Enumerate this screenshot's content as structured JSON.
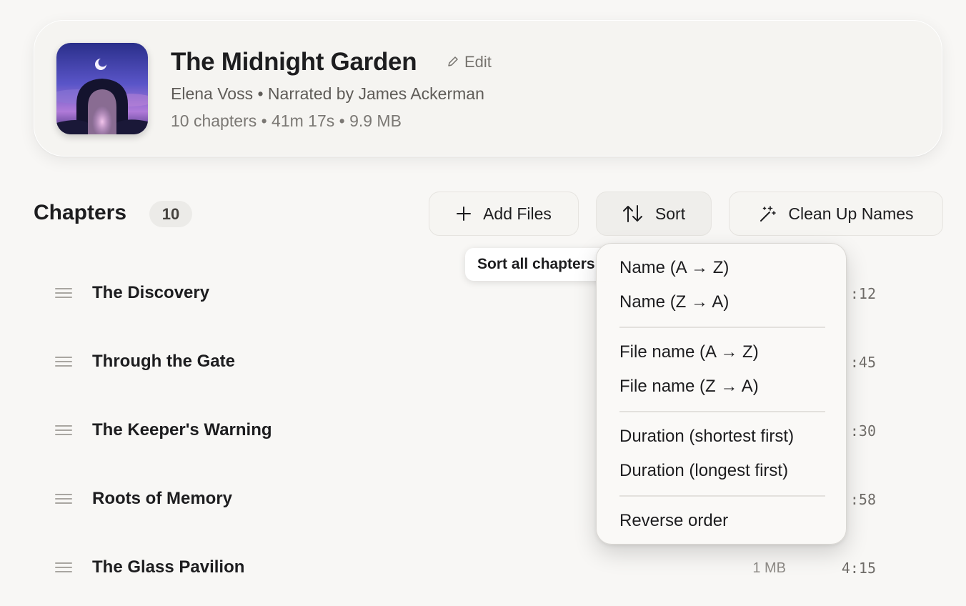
{
  "book": {
    "title": "The Midnight Garden",
    "edit_label": "Edit",
    "author_line": "Elena Voss • Narrated by James Ackerman",
    "meta_line": "10 chapters • 41m 17s • 9.9 MB",
    "cover_icon": "garden-gate-artwork"
  },
  "chapters_header": {
    "title": "Chapters",
    "count": "10",
    "add_files_label": "Add Files",
    "sort_label": "Sort",
    "clean_up_label": "Clean Up Names"
  },
  "chapters": [
    {
      "name": "The Discovery",
      "size": "",
      "duration": ":12"
    },
    {
      "name": "Through the Gate",
      "size": "",
      "duration": ":45"
    },
    {
      "name": "The Keeper's Warning",
      "size": "",
      "duration": ":30"
    },
    {
      "name": "Roots of Memory",
      "size": "",
      "duration": ":58"
    },
    {
      "name": "The Glass Pavilion",
      "size": "1 MB",
      "duration": "4:15"
    }
  ],
  "tooltip": {
    "text": "Sort all chapters"
  },
  "sort_menu": {
    "items": [
      "Name (A → Z)",
      "Name (Z → A)",
      "File name (A → Z)",
      "File name (Z → A)",
      "Duration (shortest first)",
      "Duration (longest first)",
      "Reverse order"
    ]
  },
  "colors": {
    "background": "#f8f7f5",
    "text_primary": "#1d1d1f",
    "text_secondary": "#7b7874"
  }
}
